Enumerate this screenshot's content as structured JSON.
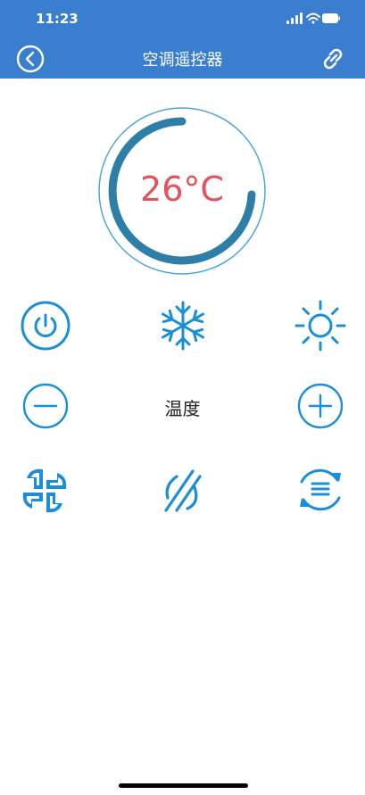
{
  "status_bar": {
    "time": "11:23",
    "icons": [
      "signal-icon",
      "wifi-icon",
      "battery-icon"
    ]
  },
  "header": {
    "title": "空调遥控器",
    "back_icon": "back-icon",
    "link_icon": "link-icon"
  },
  "dial": {
    "temperature": "26°C"
  },
  "controls": {
    "row1": [
      "power-icon",
      "snowflake-icon",
      "sun-icon"
    ],
    "row2": {
      "minus_icon": "minus-icon",
      "label": "温度",
      "plus_icon": "plus-icon"
    },
    "row3": [
      "fan-icon",
      "swing-icon",
      "mode-cycle-icon"
    ]
  },
  "colors": {
    "header": "#3a7fcf",
    "accent": "#1a8fd8",
    "temperature": "#e7515b",
    "dial": "#2e7fa8"
  }
}
